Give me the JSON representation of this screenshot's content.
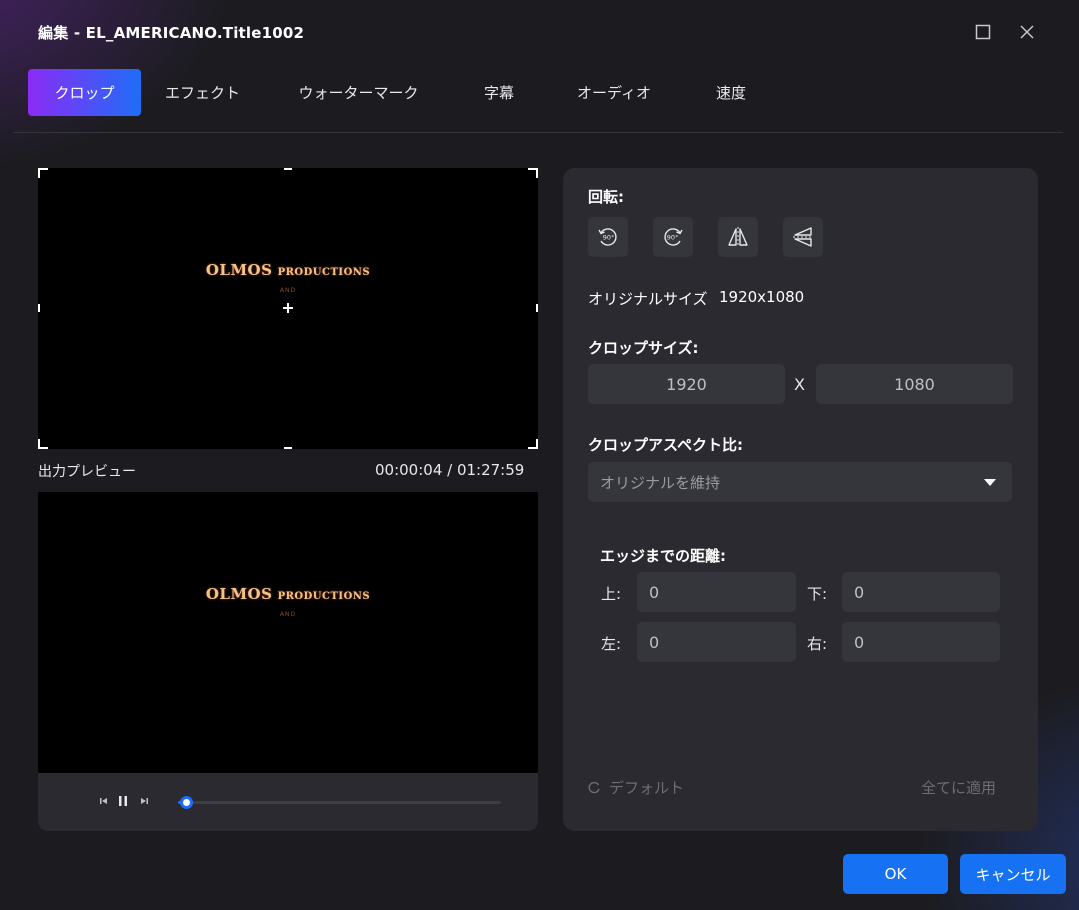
{
  "window": {
    "title": "編集 - EL_AMERICANO.Title1002"
  },
  "tabs": [
    {
      "label": "クロップ",
      "active": true
    },
    {
      "label": "エフェクト"
    },
    {
      "label": "ウォーターマーク"
    },
    {
      "label": "字幕"
    },
    {
      "label": "オーディオ"
    },
    {
      "label": "速度"
    }
  ],
  "preview": {
    "logo_title": "OLMOS",
    "logo_subtitle_word": "PRODUCTIONS",
    "logo_small": "AND",
    "output_label": "出力プレビュー",
    "timecode": "00:00:04 / 01:27:59",
    "progress": 0.02
  },
  "panel": {
    "rotate_label": "回転:",
    "rotate_buttons": [
      "rotate-left-90",
      "rotate-right-90",
      "flip-horizontal",
      "flip-vertical"
    ],
    "rotate_text": "90°",
    "original_size_label": "オリジナルサイズ",
    "original_size_value": "1920x1080",
    "crop_size_label": "クロップサイズ:",
    "crop_width": "1920",
    "crop_x": "X",
    "crop_height": "1080",
    "aspect_label": "クロップアスペクト比:",
    "aspect_value": "オリジナルを維持",
    "edge_label": "エッジまでの距離:",
    "edges": {
      "top_label": "上:",
      "top_value": "0",
      "bottom_label": "下:",
      "bottom_value": "0",
      "left_label": "左:",
      "left_value": "0",
      "right_label": "右:",
      "right_value": "0"
    },
    "default_label": "デフォルト",
    "apply_all_label": "全てに適用"
  },
  "buttons": {
    "ok": "OK",
    "cancel": "キャンセル"
  },
  "colors": {
    "accent": "#1672f3",
    "tab_gradient_start": "#8a2cf5",
    "tab_gradient_end": "#1f6df7",
    "panel": "#2a2a30",
    "field": "#35353c"
  }
}
